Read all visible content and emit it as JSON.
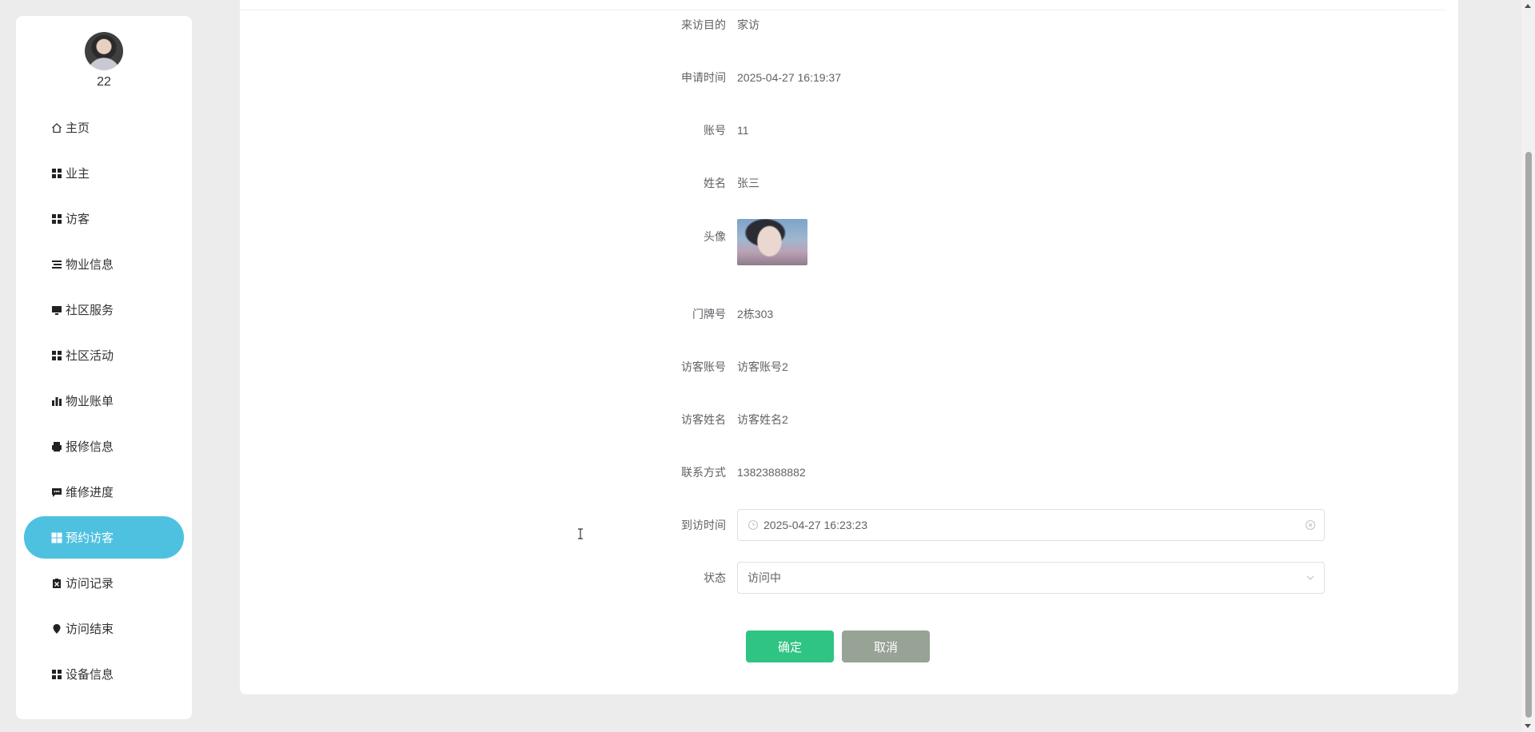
{
  "user": {
    "name": "22"
  },
  "sidebar": {
    "items": [
      {
        "label": "主页",
        "icon": "home-icon"
      },
      {
        "label": "业主",
        "icon": "grid-icon"
      },
      {
        "label": "访客",
        "icon": "grid-icon"
      },
      {
        "label": "物业信息",
        "icon": "list-icon"
      },
      {
        "label": "社区服务",
        "icon": "monitor-icon"
      },
      {
        "label": "社区活动",
        "icon": "grid-icon"
      },
      {
        "label": "物业账单",
        "icon": "bar-chart-icon"
      },
      {
        "label": "报修信息",
        "icon": "printer-icon"
      },
      {
        "label": "维修进度",
        "icon": "chat-icon"
      },
      {
        "label": "预约访客",
        "icon": "grid-icon",
        "active": true
      },
      {
        "label": "访问记录",
        "icon": "clipboard-x-icon"
      },
      {
        "label": "访问结束",
        "icon": "location-icon"
      },
      {
        "label": "设备信息",
        "icon": "grid-icon"
      }
    ]
  },
  "form": {
    "purpose": {
      "label": "来访目的",
      "value": "家访"
    },
    "apply_time": {
      "label": "申请时间",
      "value": "2025-04-27 16:19:37"
    },
    "account": {
      "label": "账号",
      "value": "11"
    },
    "name": {
      "label": "姓名",
      "value": "张三"
    },
    "avatar": {
      "label": "头像"
    },
    "door_no": {
      "label": "门牌号",
      "value": "2栋303"
    },
    "visitor_account": {
      "label": "访客账号",
      "value": "访客账号2"
    },
    "visitor_name": {
      "label": "访客姓名",
      "value": "访客姓名2"
    },
    "contact": {
      "label": "联系方式",
      "value": "13823888882"
    },
    "visit_time": {
      "label": "到访时间",
      "value": "2025-04-27 16:23:23"
    },
    "status": {
      "label": "状态",
      "value": "访问中"
    }
  },
  "buttons": {
    "confirm": "确定",
    "cancel": "取消"
  },
  "colors": {
    "accent": "#4fc1e0",
    "confirm": "#2fc483",
    "cancel": "#97a395"
  }
}
